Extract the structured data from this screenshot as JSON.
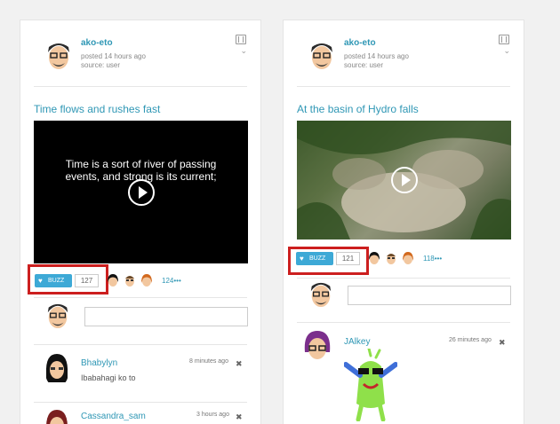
{
  "icons": [
    "film-icon",
    "chevron-down-icon",
    "heart-icon",
    "play-icon",
    "close-icon"
  ],
  "colors": {
    "accent": "#2f97b5",
    "buzz": "#3da9d6",
    "highlight": "#cc1f1f",
    "page_bg": "#f1f1f1"
  },
  "posts": [
    {
      "author": "ako-eto",
      "posted": "posted 14 hours ago",
      "source": "source: user",
      "title": "Time flows and rushes fast",
      "video_caption_line1": "Time is a sort of river of passing",
      "video_caption_line2": "events, and strong is its current;",
      "buzz_label": "BUZZ",
      "buzz_count": "127",
      "reactors_more": "124•••",
      "comments": [
        {
          "name": "Bhabylyn",
          "text": "Ibabahagi ko to",
          "time": "8 minutes ago"
        },
        {
          "name": "Cassandra_sam",
          "text": "",
          "time": "3 hours ago"
        }
      ]
    },
    {
      "author": "ako-eto",
      "posted": "posted 14 hours ago",
      "source": "source: user",
      "title": "At the basin of Hydro falls",
      "buzz_label": "BUZZ",
      "buzz_count": "121",
      "reactors_more": "118•••",
      "comments": [
        {
          "name": "JAlkey",
          "text": "",
          "time": "26 minutes ago"
        }
      ]
    }
  ]
}
